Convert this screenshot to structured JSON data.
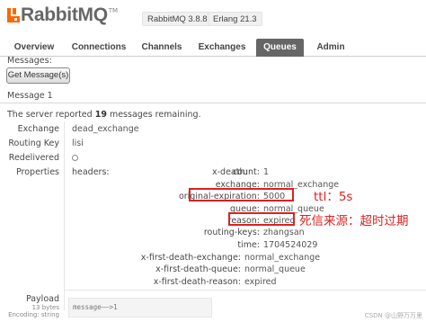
{
  "header": {
    "logo": "RabbitMQ",
    "tm": "TM",
    "rabbitmq_version": "RabbitMQ 3.8.8",
    "erlang_version": "Erlang 21.3"
  },
  "tabs": [
    {
      "label": "Overview"
    },
    {
      "label": "Connections"
    },
    {
      "label": "Channels"
    },
    {
      "label": "Exchanges"
    },
    {
      "label": "Queues",
      "active": true
    },
    {
      "label": "Admin"
    }
  ],
  "get_messages": {
    "messages_label": "Messages:",
    "button_label": "Get Message(s)"
  },
  "message": {
    "title": "Message 1",
    "remaining_prefix": "The server reported ",
    "remaining_count": "19",
    "remaining_suffix": " messages remaining.",
    "exchange_label": "Exchange",
    "exchange_value": "dead_exchange",
    "routing_key_label": "Routing Key",
    "routing_key_value": "lisi",
    "redelivered_label": "Redelivered",
    "properties_label": "Properties",
    "headers_key": "headers:",
    "xdeath_key": "x-death:",
    "xdeath": [
      {
        "key": "count:",
        "value": "1"
      },
      {
        "key": "exchange:",
        "value": "normal_exchange"
      },
      {
        "key": "original-expiration:",
        "value": "5000"
      },
      {
        "key": "queue:",
        "value": "normal_queue"
      },
      {
        "key": "reason:",
        "value": "expired"
      },
      {
        "key": "routing-keys:",
        "value": "zhangsan"
      },
      {
        "key": "time:",
        "value": "1704524029"
      }
    ],
    "first_death": [
      {
        "key": "x-first-death-exchange:",
        "value": "normal_exchange"
      },
      {
        "key": "x-first-death-queue:",
        "value": "normal_queue"
      },
      {
        "key": "x-first-death-reason:",
        "value": "expired"
      }
    ],
    "payload_label": "Payload",
    "payload_bytes": "13 bytes",
    "payload_encoding": "Encoding: string",
    "payload_value": "message——>1"
  },
  "annotations": {
    "ttl": "ttl：5s",
    "reason": "死信来源：超时过期",
    "color": "#e02020"
  },
  "watermark": "CSDN @山野万万里"
}
